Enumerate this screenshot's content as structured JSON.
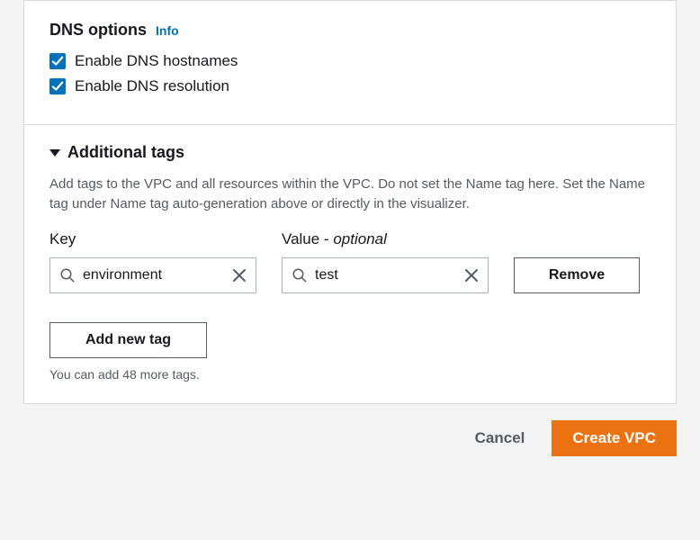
{
  "dns": {
    "title": "DNS options",
    "info_link": "Info",
    "hostnames_label": "Enable DNS hostnames",
    "hostnames_checked": true,
    "resolution_label": "Enable DNS resolution",
    "resolution_checked": true
  },
  "tags": {
    "title": "Additional tags",
    "description": "Add tags to the VPC and all resources within the VPC. Do not set the Name tag here. Set the Name tag under Name tag auto-generation above or directly in the visualizer.",
    "key_label": "Key",
    "value_label_prefix": "Value - ",
    "value_label_optional": "optional",
    "rows": [
      {
        "key": "environment",
        "value": "test"
      }
    ],
    "remove_label": "Remove",
    "add_label": "Add new tag",
    "remaining_hint": "You can add 48 more tags."
  },
  "footer": {
    "cancel": "Cancel",
    "submit": "Create VPC"
  },
  "colors": {
    "primary": "#ec7211",
    "link": "#0073bb"
  }
}
